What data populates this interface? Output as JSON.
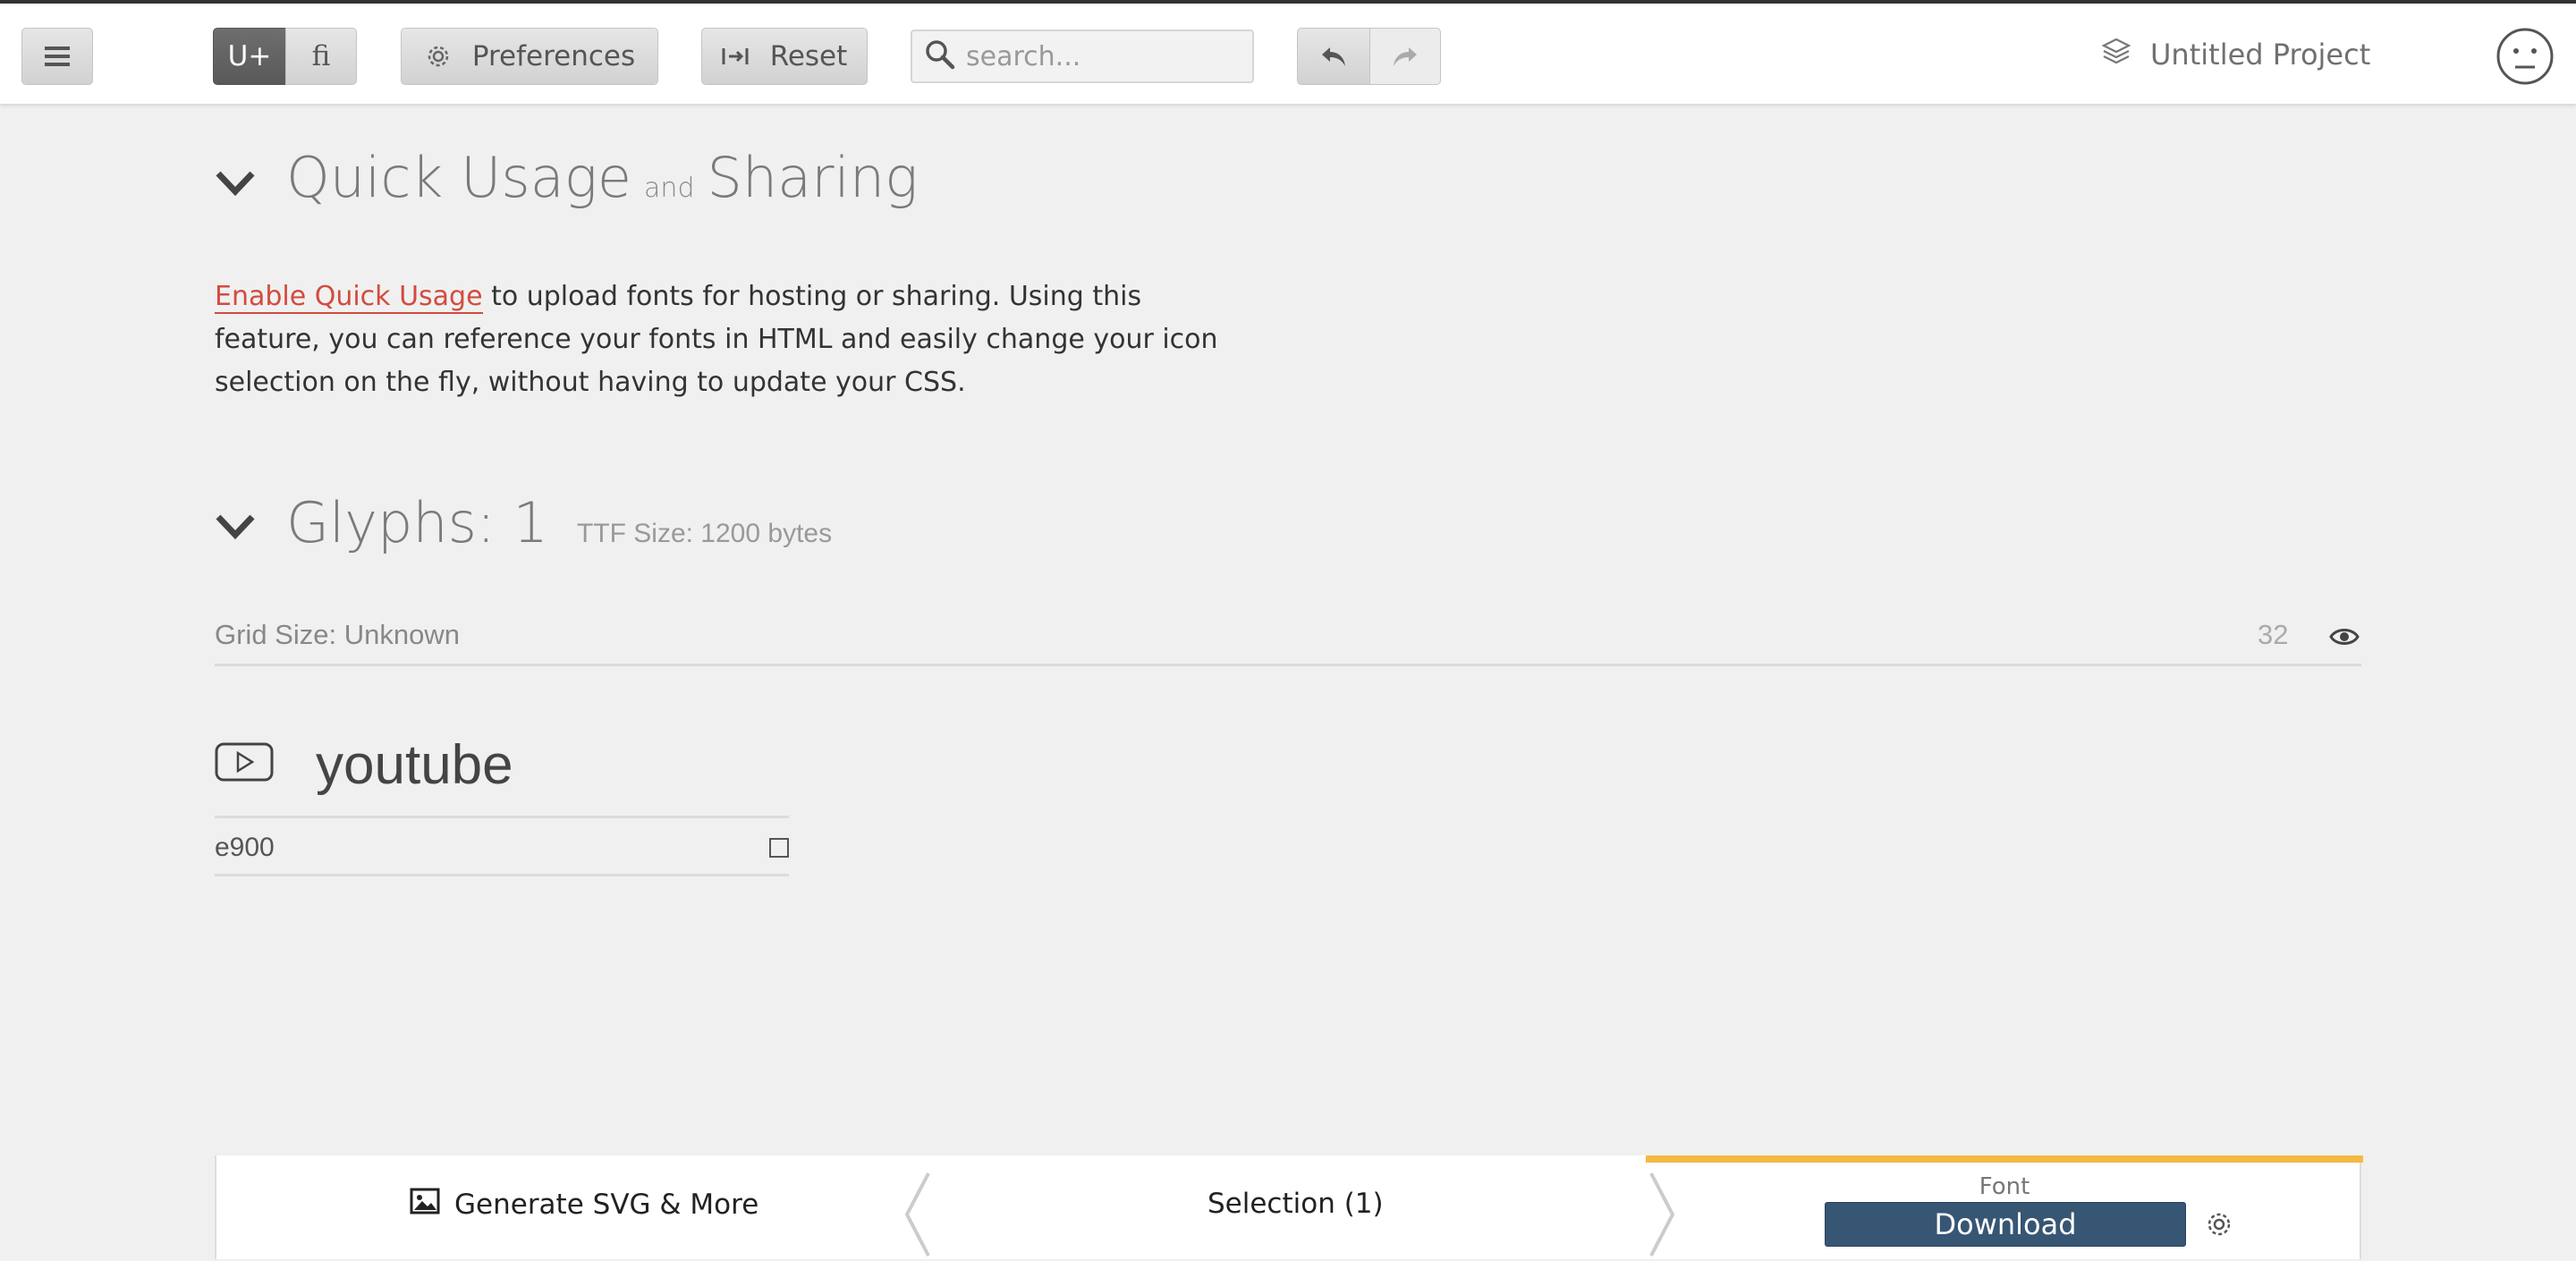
{
  "toolbar": {
    "menu_icon": "hamburger-menu-icon",
    "unicode_label": "U+",
    "ligature_label": "fi",
    "preferences_label": "Preferences",
    "reset_label": "Reset",
    "search_placeholder": "search...",
    "project_name": "Untitled Project",
    "avatar_icon": "neutral-face-icon"
  },
  "quick_usage": {
    "title_left": "Quick Usage",
    "title_and": "and",
    "title_right": "Sharing",
    "enable_link": "Enable Quick Usage",
    "description_rest": " to upload fonts for hosting or sharing. Using this feature, you can reference your fonts in HTML and easily change your icon selection on the fly, without having to update your CSS."
  },
  "glyphs": {
    "title": "Glyphs: 1",
    "ttf_size": "TTF Size: 1200 bytes",
    "grid_size": "Grid Size: Unknown",
    "preview_size": "32",
    "items": [
      {
        "name": "youtube",
        "code": "e900",
        "icon": "youtube-icon"
      }
    ]
  },
  "footer": {
    "generate_label": "Generate SVG & More",
    "selection_label": "Selection (1)",
    "font_label": "Font",
    "download_label": "Download",
    "accent_color": "#f4b942",
    "download_color": "#375674"
  }
}
